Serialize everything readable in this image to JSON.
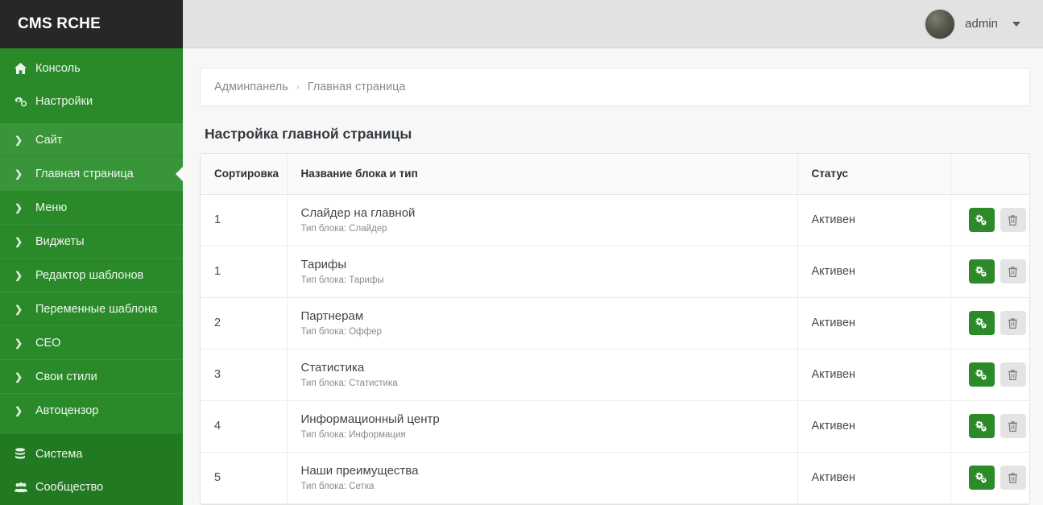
{
  "brand": {
    "title": "CMS RCHE"
  },
  "sidebar": {
    "top_links": [
      {
        "icon": "home-icon",
        "label": "Консоль"
      },
      {
        "icon": "cogs-icon",
        "label": "Настройки"
      }
    ],
    "tree_items": [
      {
        "label": "Сайт",
        "selected": true,
        "caret": false
      },
      {
        "label": "Главная страница",
        "selected": true,
        "caret": true
      },
      {
        "label": "Меню",
        "selected": false,
        "caret": false
      },
      {
        "label": "Виджеты",
        "selected": false,
        "caret": false
      },
      {
        "label": "Редактор шаблонов",
        "selected": false,
        "caret": false
      },
      {
        "label": "Переменные шаблона",
        "selected": false,
        "caret": false
      },
      {
        "label": "CEO",
        "selected": false,
        "caret": false
      },
      {
        "label": "Свои стили",
        "selected": false,
        "caret": false
      },
      {
        "label": "Автоцензор",
        "selected": false,
        "caret": false
      }
    ],
    "bottom_links": [
      {
        "icon": "database-icon",
        "label": "Система"
      },
      {
        "icon": "users-icon",
        "label": "Сообщество"
      }
    ],
    "colors": {
      "bg": "#2a8a29",
      "bg_dark": "#217a21",
      "selected": "#38953a",
      "brand_bg": "#272727"
    }
  },
  "topbar": {
    "user_name": "admin",
    "avatar": "user-avatar",
    "dropdown_icon": "chevron-down-icon"
  },
  "breadcrumb": {
    "root": "Админпанель",
    "separator": "›",
    "current": "Главная страница"
  },
  "page": {
    "title": "Настройка главной страницы"
  },
  "table": {
    "columns": [
      "Сортировка",
      "Название блока и тип",
      "Статус",
      ""
    ],
    "type_prefix": "Тип блока: ",
    "rows": [
      {
        "sort": "1",
        "name": "Слайдер на главной",
        "type": "Тип блока: Слайдер",
        "status": "Активен"
      },
      {
        "sort": "1",
        "name": "Тарифы",
        "type": "Тип блока: Тарифы",
        "status": "Активен"
      },
      {
        "sort": "2",
        "name": "Партнерам",
        "type": "Тип блока: Оффер",
        "status": "Активен"
      },
      {
        "sort": "3",
        "name": "Статистика",
        "type": "Тип блока: Статистика",
        "status": "Активен"
      },
      {
        "sort": "4",
        "name": "Информационный центр",
        "type": "Тип блока: Информация",
        "status": "Активен"
      },
      {
        "sort": "5",
        "name": "Наши преимущества",
        "type": "Тип блока: Сетка",
        "status": "Активен"
      }
    ],
    "actions": {
      "settings_icon": "cogs-icon",
      "delete_icon": "trash-icon"
    },
    "colors": {
      "settings_button": "#2c8a28",
      "delete_button": "#e4e4e4"
    }
  }
}
